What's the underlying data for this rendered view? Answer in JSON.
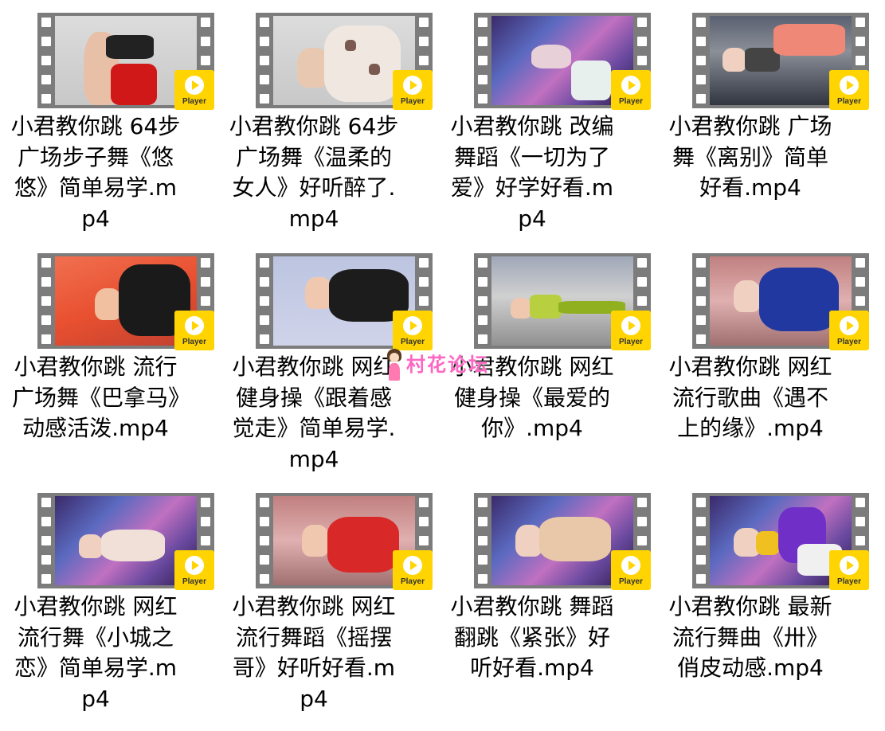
{
  "items": [
    {
      "name": "小君教你跳 64步广场步子舞《悠悠》简单易学.mp4",
      "badge": "Player"
    },
    {
      "name": "小君教你跳 64步广场舞《温柔的女人》好听醉了.mp4",
      "badge": "Player"
    },
    {
      "name": "小君教你跳 改编舞蹈《一切为了爱》好学好看.mp4",
      "badge": "Player"
    },
    {
      "name": "小君教你跳 广场舞《离别》简单好看.mp4",
      "badge": "Player"
    },
    {
      "name": "小君教你跳 流行广场舞《巴拿马》动感活泼.mp4",
      "badge": "Player"
    },
    {
      "name": "小君教你跳 网红健身操《跟着感觉走》简单易学.mp4",
      "badge": "Player"
    },
    {
      "name": "小君教你跳 网红健身操《最爱的你》.mp4",
      "badge": "Player"
    },
    {
      "name": "小君教你跳 网红流行歌曲《遇不上的缘》.mp4",
      "badge": "Player"
    },
    {
      "name": "小君教你跳 网红流行舞《小城之恋》简单易学.mp4",
      "badge": "Player"
    },
    {
      "name": "小君教你跳 网红流行舞蹈《摇摆哥》好听好看.mp4",
      "badge": "Player"
    },
    {
      "name": "小君教你跳 舞蹈翻跳《紧张》好听好看.mp4",
      "badge": "Player"
    },
    {
      "name": "小君教你跳 最新流行舞曲《卅》俏皮动感.mp4",
      "badge": "Player"
    }
  ],
  "watermark": {
    "text": "村花论坛",
    "icon": "girl-avatar-icon"
  },
  "colors": {
    "badge": "#ffd400",
    "film": "#7c7c7c",
    "watermark": "#ff66c4"
  }
}
